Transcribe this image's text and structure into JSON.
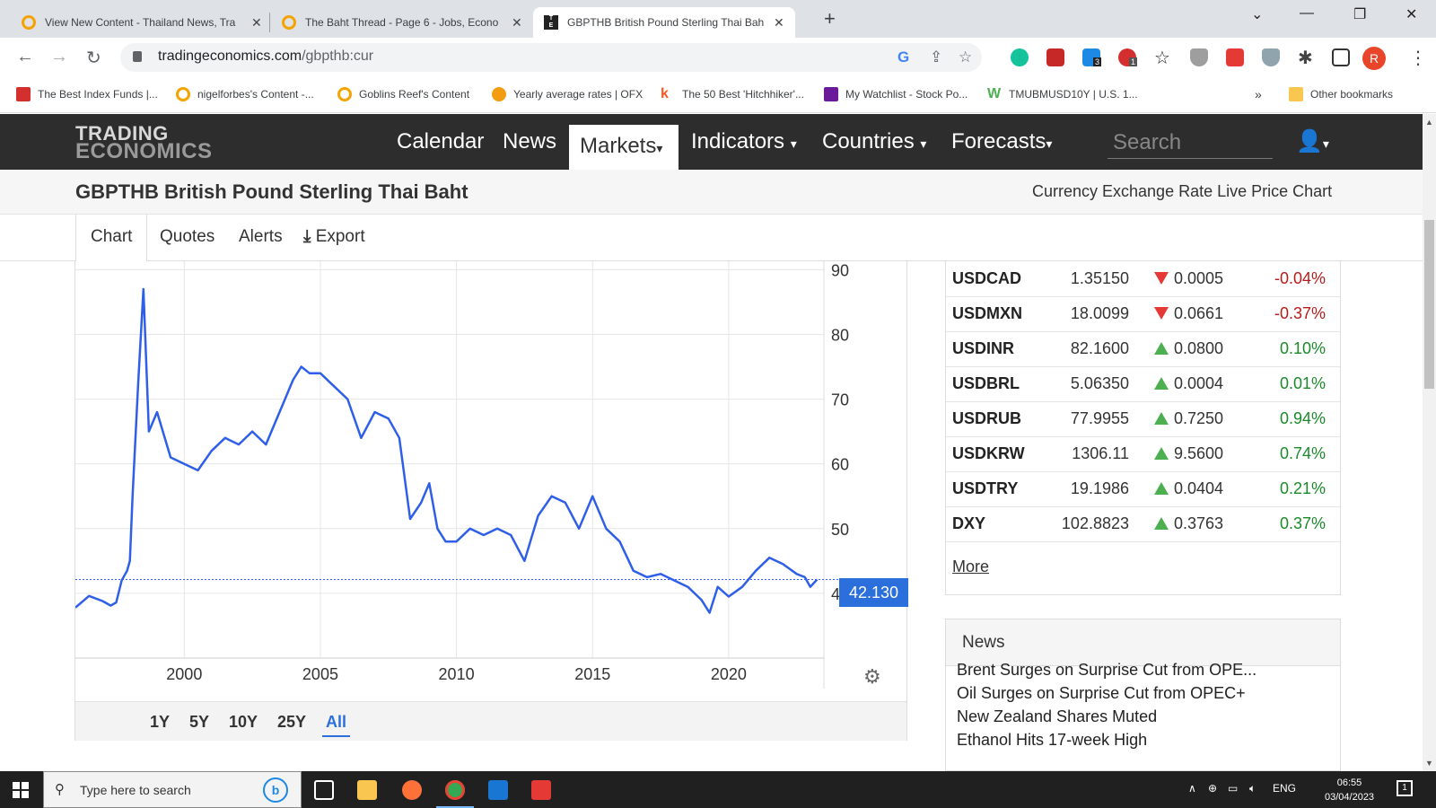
{
  "browser": {
    "tabs": [
      {
        "title": "View New Content - Thailand News, Tra"
      },
      {
        "title": "The Baht Thread - Page 6 - Jobs, Econo"
      },
      {
        "title": "GBPTHB British Pound Sterling Thai Bah"
      }
    ],
    "url_host": "tradingeconomics.com",
    "url_path": "/gbpthb:cur",
    "bookmarks": [
      "The Best Index Funds |...",
      "nigelforbes's Content -...",
      "Goblins Reef's Content",
      "Yearly average rates | OFX",
      "The 50 Best 'Hitchhiker'...",
      "My Watchlist - Stock Po...",
      "TMUBMUSD10Y | U.S. 1...",
      "Other bookmarks"
    ],
    "bookmarks_overflow": "»",
    "profile_initial": "R",
    "ext_badges": [
      "3",
      "1"
    ]
  },
  "site": {
    "logo_line1": "TRADING",
    "logo_line2": "ECONOMICS",
    "menu": [
      "Calendar",
      "News",
      "Markets",
      "Indicators",
      "Countries",
      "Forecasts"
    ],
    "search_placeholder": "Search",
    "title": "GBPTHB British Pound Sterling Thai Baht",
    "subtitle": "Currency Exchange Rate Live Price Chart",
    "tabs": [
      "Chart",
      "Quotes",
      "Alerts",
      "Export"
    ]
  },
  "chart_data": {
    "type": "line",
    "series": [
      {
        "color": "#2f5fe8",
        "x": [
          1996.0,
          1996.5,
          1997.0,
          1997.3,
          1997.5,
          1997.7,
          1997.9,
          1998.0,
          1998.1,
          1998.3,
          1998.5,
          1998.7,
          1999.0,
          1999.5,
          2000.0,
          2000.5,
          2001.0,
          2001.5,
          2002.0,
          2002.5,
          2003.0,
          2003.5,
          2004.0,
          2004.3,
          2004.6,
          2005.0,
          2005.5,
          2006.0,
          2006.5,
          2007.0,
          2007.5,
          2007.9,
          2008.3,
          2008.7,
          2009.0,
          2009.3,
          2009.6,
          2010.0,
          2010.5,
          2011.0,
          2011.5,
          2012.0,
          2012.5,
          2013.0,
          2013.5,
          2014.0,
          2014.5,
          2015.0,
          2015.5,
          2016.0,
          2016.5,
          2017.0,
          2017.5,
          2018.0,
          2018.5,
          2019.0,
          2019.3,
          2019.6,
          2020.0,
          2020.5,
          2021.0,
          2021.5,
          2022.0,
          2022.5,
          2022.8,
          2023.0,
          2023.25
        ],
        "y": [
          37.8,
          39.6,
          38.8,
          38.1,
          38.6,
          42.0,
          43.5,
          45.0,
          55.0,
          72.0,
          87.0,
          65.0,
          68.0,
          61.0,
          60.0,
          59.0,
          62.0,
          64.0,
          63.0,
          65.0,
          63.0,
          68.0,
          73.0,
          75.0,
          74.0,
          74.0,
          72.0,
          70.0,
          64.0,
          68.0,
          67.0,
          64.0,
          51.5,
          54.0,
          57.0,
          50.0,
          48.0,
          48.0,
          50.0,
          49.0,
          50.0,
          49.0,
          45.0,
          52.0,
          55.0,
          54.0,
          50.0,
          55.0,
          50.0,
          48.0,
          43.5,
          42.5,
          43.0,
          42.0,
          41.0,
          39.0,
          37.0,
          41.0,
          39.5,
          41.0,
          43.5,
          45.5,
          44.5,
          43.0,
          42.5,
          41.0,
          42.13
        ]
      }
    ],
    "xlim": [
      1996,
      2023.5
    ],
    "ylim": [
      30,
      91.3
    ],
    "yticks": [
      40,
      50,
      60,
      70,
      80,
      90
    ],
    "xticks": [
      2000,
      2005,
      2010,
      2015,
      2020
    ],
    "last_value": "42.130",
    "grid": true,
    "ranges": [
      "1Y",
      "5Y",
      "10Y",
      "25Y",
      "All"
    ],
    "active_range": "All"
  },
  "rates": [
    {
      "symbol": "USDCAD",
      "price": "1.35150",
      "dir": "down",
      "change": "0.0005",
      "pct": "-0.04%"
    },
    {
      "symbol": "USDMXN",
      "price": "18.0099",
      "dir": "down",
      "change": "0.0661",
      "pct": "-0.37%"
    },
    {
      "symbol": "USDINR",
      "price": "82.1600",
      "dir": "up",
      "change": "0.0800",
      "pct": "0.10%"
    },
    {
      "symbol": "USDBRL",
      "price": "5.06350",
      "dir": "up",
      "change": "0.0004",
      "pct": "0.01%"
    },
    {
      "symbol": "USDRUB",
      "price": "77.9955",
      "dir": "up",
      "change": "0.7250",
      "pct": "0.94%"
    },
    {
      "symbol": "USDKRW",
      "price": "1306.11",
      "dir": "up",
      "change": "9.5600",
      "pct": "0.74%"
    },
    {
      "symbol": "USDTRY",
      "price": "19.1986",
      "dir": "up",
      "change": "0.0404",
      "pct": "0.21%"
    },
    {
      "symbol": "DXY",
      "price": "102.8823",
      "dir": "up",
      "change": "0.3763",
      "pct": "0.37%"
    }
  ],
  "rates_more": "More",
  "news": {
    "header": "News",
    "items": [
      "Brent Surges on Surprise Cut from OPE...",
      "Oil Surges on Surprise Cut from OPEC+",
      "New Zealand Shares Muted",
      "Ethanol Hits 17-week High"
    ]
  },
  "taskbar": {
    "search_placeholder": "Type here to search",
    "lang": "ENG",
    "time": "06:55",
    "date": "03/04/2023",
    "notif_count": "1"
  }
}
